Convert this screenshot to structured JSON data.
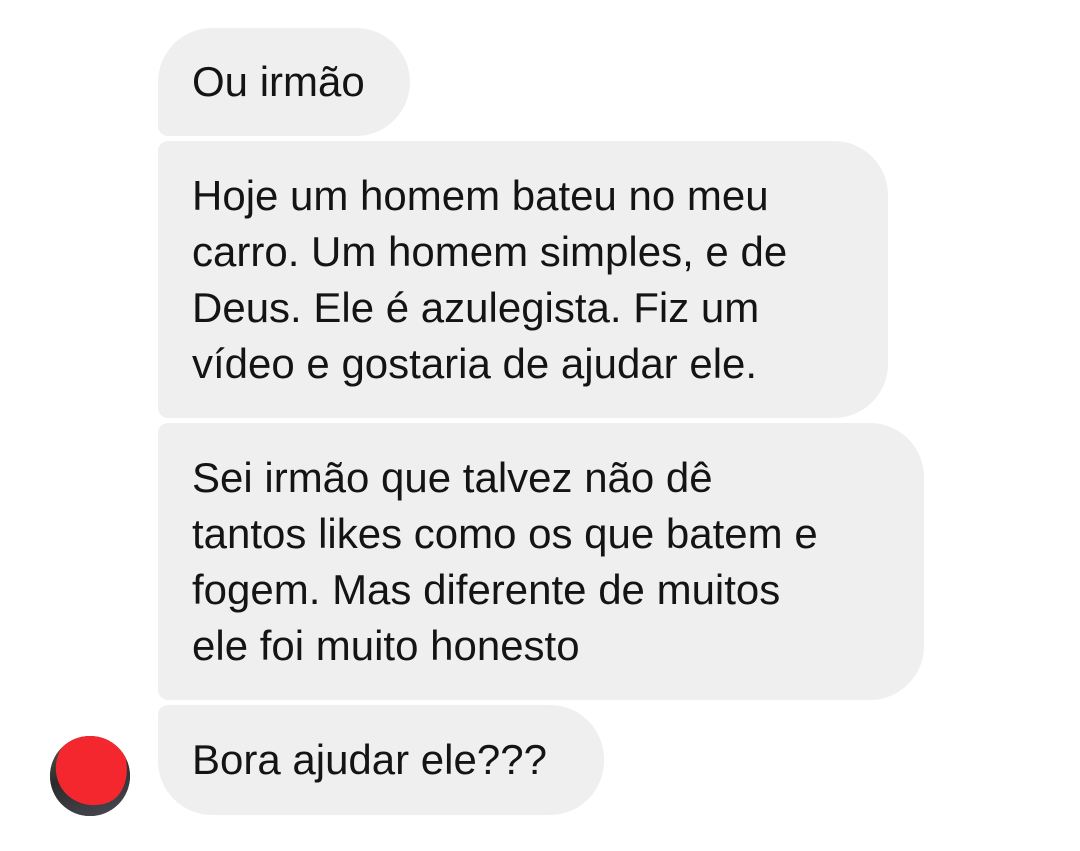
{
  "conversation": {
    "messages": [
      {
        "text": "Ou irmão"
      },
      {
        "text": "Hoje um homem bateu no meu\ncarro. Um homem simples, e de\nDeus. Ele é azulegista. Fiz um\nvídeo e gostaria de ajudar ele."
      },
      {
        "text": "Sei irmão que talvez não dê\ntantos likes como os que batem e\nfogem. Mas diferente de muitos\nele foi muito honesto"
      },
      {
        "text": "Bora ajudar ele???"
      }
    ],
    "sender_avatar": {
      "icon": "avatar-redacted",
      "redaction_color": "#f5272e"
    }
  },
  "colors": {
    "bubble_bg": "#efefef",
    "text": "#141414",
    "background": "#ffffff"
  }
}
